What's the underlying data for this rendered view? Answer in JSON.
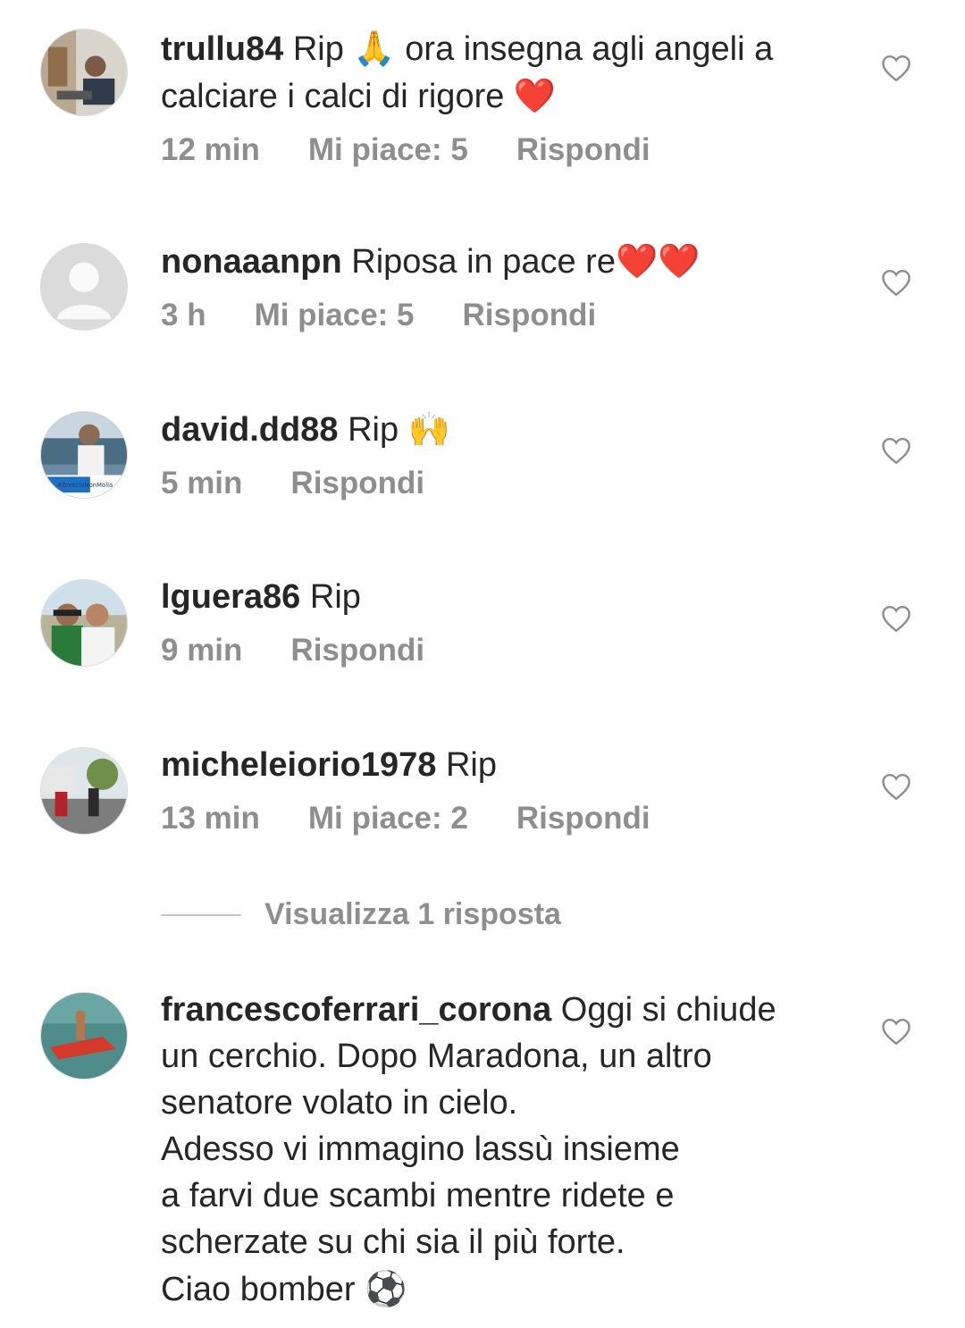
{
  "comments": [
    {
      "username": "trullu84",
      "text_parts": [
        "Rip ",
        "🙏",
        " ora insegna agli angeli a calciare i calci di rigore ",
        "❤️"
      ],
      "time": "12 min",
      "likes": "Mi piace: 5",
      "reply": "Rispondi"
    },
    {
      "username": "nonaaanpn",
      "text_parts": [
        "Riposa in pace re",
        "❤️❤️"
      ],
      "time": "3 h",
      "likes": "Mi piace: 5",
      "reply": "Rispondi"
    },
    {
      "username": "david.dd88",
      "text_parts": [
        "Rip ",
        "🙌"
      ],
      "avatar_caption": "#BresciaNonMolla",
      "time": "5 min",
      "reply": "Rispondi"
    },
    {
      "username": "lguera86",
      "text_parts": [
        "Rip"
      ],
      "time": "9 min",
      "reply": "Rispondi"
    },
    {
      "username": "micheleiorio1978",
      "text_parts": [
        "Rip"
      ],
      "time": "13 min",
      "likes": "Mi piace: 2",
      "reply": "Rispondi"
    },
    {
      "username": "francescoferrari_corona",
      "text_lines": [
        "Oggi si chiude",
        "un cerchio. Dopo Maradona, un altro",
        "senatore volato in cielo.",
        "Adesso vi immagino lassù insieme",
        "a farvi due scambi mentre ridete e",
        "scherzate su chi sia il più forte.",
        "Ciao bomber"
      ],
      "end_emoji": "⚽"
    }
  ],
  "view_replies": "Visualizza 1 risposta",
  "icons": {
    "like": "heart-outline-icon"
  },
  "colors": {
    "text": "#262626",
    "meta": "#8e8e8e",
    "heart": "#e31b23"
  }
}
